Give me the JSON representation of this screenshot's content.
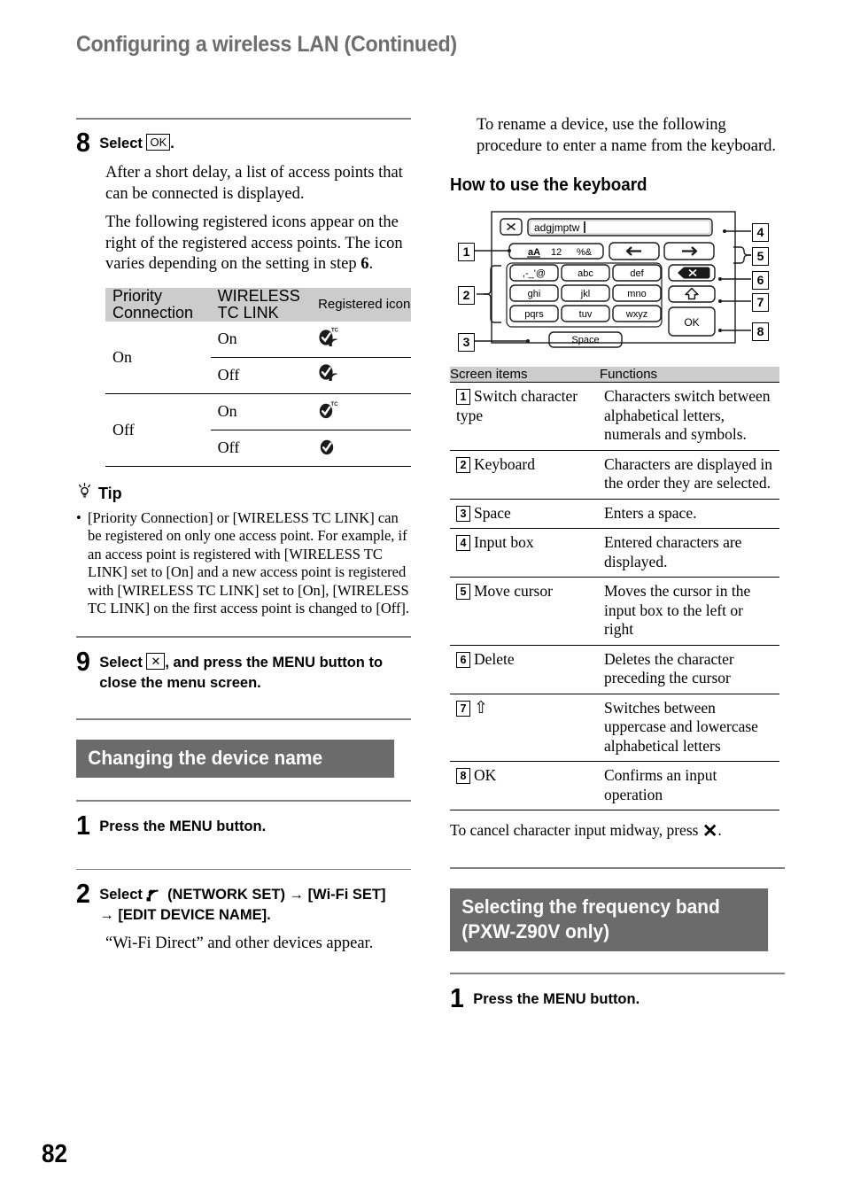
{
  "page": {
    "chapter_title": "Configuring a wireless LAN (Continued)",
    "page_number": "82"
  },
  "left_column": {
    "step8": {
      "number": "8",
      "title_prefix": "Select",
      "key_label": "OK",
      "title_suffix": ".",
      "paragraph1": "After a short delay, a list of access points that can be connected is displayed.",
      "paragraph2_a": "The following registered icons appear on the right of the registered access points. The icon varies depending on the setting in step ",
      "paragraph2_step": "6",
      "paragraph2_b": "."
    },
    "icon_table": {
      "headers": [
        "Priority Connection",
        "WIRELESS TC LINK",
        "Registered icon"
      ],
      "rows": [
        {
          "priority": "On",
          "tc": "On",
          "icon": "check-tc-antenna-icon"
        },
        {
          "priority": "On",
          "tc": "Off",
          "icon": "check-antenna-icon"
        },
        {
          "priority": "Off",
          "tc": "On",
          "icon": "check-tc-icon"
        },
        {
          "priority": "Off",
          "tc": "Off",
          "icon": "check-icon"
        }
      ]
    },
    "tip": {
      "icon": "lightbulb-icon",
      "label": "Tip",
      "bullet": "•",
      "text": "[Priority Connection] or [WIRELESS TC LINK] can be registered on only one access point. For example, if an access point is registered with [WIRELESS TC LINK] set to [On] and a new access point is registered with [WIRELESS TC LINK] set to [On], [WIRELESS TC LINK] on the first access point is changed to [Off]."
    },
    "step9": {
      "number": "9",
      "title_prefix": "Select",
      "key_label": "✕",
      "title_suffix": ", and press the MENU button to close the menu screen."
    },
    "section_device_name": {
      "heading": "Changing the device name"
    },
    "step1": {
      "number": "1",
      "title": "Press the MENU button."
    },
    "step2": {
      "number": "2",
      "title_prefix": "Select",
      "icon": "network-wifi-icon",
      "title_line1": "(NETWORK SET) →",
      "title_line2": "[Wi-Fi SET] → [EDIT DEVICE NAME].",
      "paragraph": "“Wi-Fi Direct” and other devices appear."
    }
  },
  "right_column": {
    "intro_paragraph": "To rename a device, use the following procedure to enter a name from the keyboard.",
    "subhead": "How to use the keyboard",
    "keyboard_diagram": {
      "close_button": "✕",
      "input_box_value": "adgjmptw",
      "char_type_keys": [
        "aA",
        "12",
        "%&"
      ],
      "cursor_keys": [
        "←",
        "→"
      ],
      "keypad": [
        [
          ",-_'@",
          "abc",
          "def"
        ],
        [
          "ghi",
          "jkl",
          "mno"
        ],
        [
          "pqrs",
          "tuv",
          "wxyz"
        ]
      ],
      "space_key": "Space",
      "delete_key": "delete-icon",
      "shift_key": "⇧",
      "ok_key": "OK",
      "callouts": [
        "1",
        "2",
        "3",
        "4",
        "5",
        "6",
        "7",
        "8"
      ]
    },
    "function_table": {
      "headers": [
        "Screen items",
        "Functions"
      ],
      "rows": [
        {
          "num": "1",
          "item": "Switch character type",
          "func": "Characters switch between alphabetical letters, numerals and symbols."
        },
        {
          "num": "2",
          "item": "Keyboard",
          "func": "Characters are displayed in the order they are selected."
        },
        {
          "num": "3",
          "item": "Space",
          "func": "Enters a space."
        },
        {
          "num": "4",
          "item": "Input box",
          "func": "Entered characters are displayed."
        },
        {
          "num": "5",
          "item": "Move cursor",
          "func": "Moves the cursor in the input box to the left or right"
        },
        {
          "num": "6",
          "item": "Delete",
          "func": "Deletes the character preceding the cursor"
        },
        {
          "num": "7",
          "item": "⇧",
          "func": "Switches between uppercase and lowercase alphabetical letters"
        },
        {
          "num": "8",
          "item": "OK",
          "func": "Confirms an input operation"
        }
      ]
    },
    "closing_text_a": "To cancel character input midway, press",
    "closing_icon": "✕",
    "closing_text_b": ".",
    "section_frequency": {
      "heading_line1": "Selecting the frequency band",
      "heading_line2": "(PXW-Z90V only)"
    },
    "step1": {
      "number": "1",
      "title": "Press the MENU button."
    }
  }
}
